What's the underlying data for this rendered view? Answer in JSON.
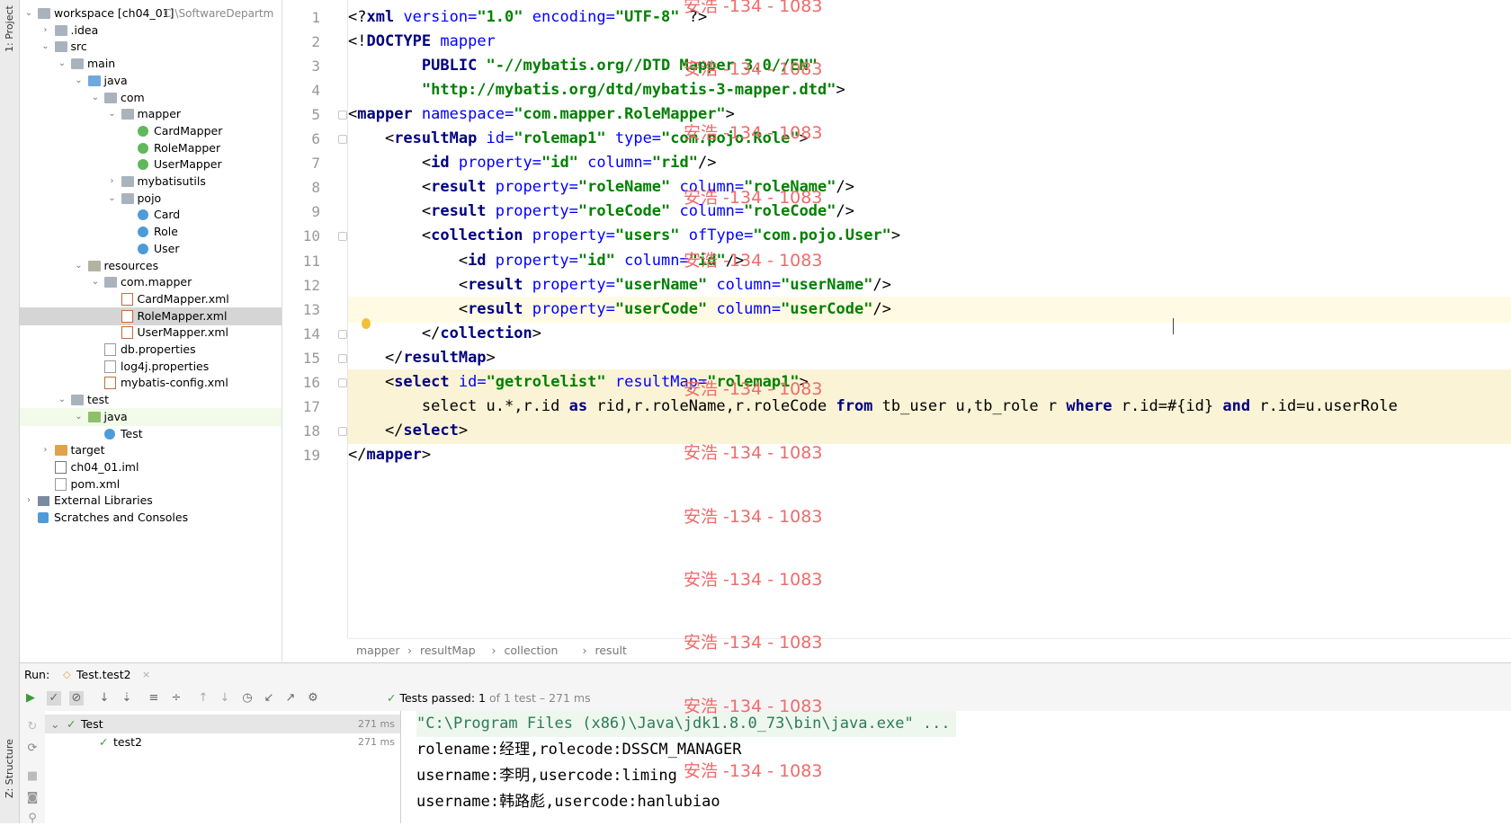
{
  "side_tabs": {
    "project": "1: Project",
    "structure": "Z: Structure"
  },
  "project_tree": [
    {
      "label": "workspace [ch04_01]",
      "hint": "C:\\SoftwareDepartm",
      "indent": 0,
      "chev": "v",
      "icon": "folder"
    },
    {
      "label": ".idea",
      "indent": 1,
      "chev": ">",
      "icon": "folder"
    },
    {
      "label": "src",
      "indent": 1,
      "chev": "v",
      "icon": "folder"
    },
    {
      "label": "main",
      "indent": 2,
      "chev": "v",
      "icon": "folder"
    },
    {
      "label": "java",
      "indent": 3,
      "chev": "v",
      "icon": "folder blue"
    },
    {
      "label": "com",
      "indent": 4,
      "chev": "v",
      "icon": "folder"
    },
    {
      "label": "mapper",
      "indent": 5,
      "chev": "v",
      "icon": "folder"
    },
    {
      "label": "CardMapper",
      "indent": 6,
      "chev": "",
      "icon": "interface"
    },
    {
      "label": "RoleMapper",
      "indent": 6,
      "chev": "",
      "icon": "interface"
    },
    {
      "label": "UserMapper",
      "indent": 6,
      "chev": "",
      "icon": "interface"
    },
    {
      "label": "mybatisutils",
      "indent": 5,
      "chev": ">",
      "icon": "folder"
    },
    {
      "label": "pojo",
      "indent": 5,
      "chev": "v",
      "icon": "folder"
    },
    {
      "label": "Card",
      "indent": 6,
      "chev": "",
      "icon": "klass"
    },
    {
      "label": "Role",
      "indent": 6,
      "chev": "",
      "icon": "klass"
    },
    {
      "label": "User",
      "indent": 6,
      "chev": "",
      "icon": "klass"
    },
    {
      "label": "resources",
      "indent": 3,
      "chev": "v",
      "icon": "folder res"
    },
    {
      "label": "com.mapper",
      "indent": 4,
      "chev": "v",
      "icon": "folder"
    },
    {
      "label": "CardMapper.xml",
      "indent": 5,
      "chev": "",
      "icon": "file"
    },
    {
      "label": "RoleMapper.xml",
      "indent": 5,
      "chev": "",
      "icon": "file",
      "state": "sel"
    },
    {
      "label": "UserMapper.xml",
      "indent": 5,
      "chev": "",
      "icon": "file"
    },
    {
      "label": "db.properties",
      "indent": 4,
      "chev": "",
      "icon": "props"
    },
    {
      "label": "log4j.properties",
      "indent": 4,
      "chev": "",
      "icon": "props"
    },
    {
      "label": "mybatis-config.xml",
      "indent": 4,
      "chev": "",
      "icon": "file"
    },
    {
      "label": "test",
      "indent": 2,
      "chev": "v",
      "icon": "folder"
    },
    {
      "label": "java",
      "indent": 3,
      "chev": "v",
      "icon": "folder green",
      "state": "gsel"
    },
    {
      "label": "Test",
      "indent": 4,
      "chev": "",
      "icon": "klass"
    },
    {
      "label": "target",
      "indent": 1,
      "chev": ">",
      "icon": "folder orange"
    },
    {
      "label": "ch04_01.iml",
      "indent": 1,
      "chev": "",
      "icon": "iml"
    },
    {
      "label": "pom.xml",
      "indent": 1,
      "chev": "",
      "icon": "props"
    },
    {
      "label": "External Libraries",
      "indent": 0,
      "chev": ">",
      "icon": "lib"
    },
    {
      "label": "Scratches and Consoles",
      "indent": 0,
      "chev": "",
      "icon": "scratch"
    }
  ],
  "editor": {
    "line_numbers": [
      "1",
      "2",
      "3",
      "4",
      "5",
      "6",
      "7",
      "8",
      "9",
      "10",
      "11",
      "12",
      "13",
      "14",
      "15",
      "16",
      "17",
      "18",
      "19"
    ],
    "lines": [
      [
        [
          "plain",
          "<?"
        ],
        [
          "tag",
          "xml"
        ],
        [
          "attr",
          " version="
        ],
        [
          "val",
          "\"1.0\""
        ],
        [
          "attr",
          " encoding="
        ],
        [
          "val",
          "\"UTF-8\""
        ],
        [
          "plain",
          " ?>"
        ]
      ],
      [
        [
          "plain",
          "<!"
        ],
        [
          "tag",
          "DOCTYPE"
        ],
        [
          "attr",
          " mapper"
        ]
      ],
      [
        [
          "plain",
          "        "
        ],
        [
          "tag",
          "PUBLIC"
        ],
        [
          "val",
          " \"-//mybatis.org//DTD Mapper 3.0//EN\""
        ]
      ],
      [
        [
          "plain",
          "        "
        ],
        [
          "val",
          "\"http://mybatis.org/dtd/mybatis-3-mapper.dtd\""
        ],
        [
          "plain",
          ">"
        ]
      ],
      [
        [
          "plain",
          "<"
        ],
        [
          "tag",
          "mapper"
        ],
        [
          "attr",
          " namespace="
        ],
        [
          "val",
          "\"com.mapper.RoleMapper\""
        ],
        [
          "plain",
          ">"
        ]
      ],
      [
        [
          "plain",
          "    <"
        ],
        [
          "tag",
          "resultMap"
        ],
        [
          "attr",
          " id="
        ],
        [
          "val",
          "\"rolemap1\""
        ],
        [
          "attr",
          " type="
        ],
        [
          "val",
          "\"com.pojo.Role\""
        ],
        [
          "plain",
          ">"
        ]
      ],
      [
        [
          "plain",
          "        <"
        ],
        [
          "tag",
          "id"
        ],
        [
          "attr",
          " property="
        ],
        [
          "val",
          "\"id\""
        ],
        [
          "attr",
          " column="
        ],
        [
          "val",
          "\"rid\""
        ],
        [
          "plain",
          "/>"
        ]
      ],
      [
        [
          "plain",
          "        <"
        ],
        [
          "tag",
          "result"
        ],
        [
          "attr",
          " property="
        ],
        [
          "val",
          "\"roleName\""
        ],
        [
          "attr",
          " column="
        ],
        [
          "val",
          "\"roleName\""
        ],
        [
          "plain",
          "/>"
        ]
      ],
      [
        [
          "plain",
          "        <"
        ],
        [
          "tag",
          "result"
        ],
        [
          "attr",
          " property="
        ],
        [
          "val",
          "\"roleCode\""
        ],
        [
          "attr",
          " column="
        ],
        [
          "val",
          "\"roleCode\""
        ],
        [
          "plain",
          "/>"
        ]
      ],
      [
        [
          "plain",
          "        <"
        ],
        [
          "tag",
          "collection"
        ],
        [
          "attr",
          " property="
        ],
        [
          "val",
          "\"users\""
        ],
        [
          "attr",
          " ofType="
        ],
        [
          "val",
          "\"com.pojo.User\""
        ],
        [
          "plain",
          ">"
        ]
      ],
      [
        [
          "plain",
          "            <"
        ],
        [
          "tag",
          "id"
        ],
        [
          "attr",
          " property="
        ],
        [
          "val",
          "\"id\""
        ],
        [
          "attr",
          " column="
        ],
        [
          "val",
          "\"id\""
        ],
        [
          "plain",
          "/>"
        ]
      ],
      [
        [
          "plain",
          "            <"
        ],
        [
          "tag",
          "result"
        ],
        [
          "attr",
          " property="
        ],
        [
          "val",
          "\"userName\""
        ],
        [
          "attr",
          " column="
        ],
        [
          "val",
          "\"userName\""
        ],
        [
          "plain",
          "/>"
        ]
      ],
      [
        [
          "plain",
          "            <"
        ],
        [
          "tag",
          "result"
        ],
        [
          "attr",
          " property="
        ],
        [
          "val",
          "\"userCode\""
        ],
        [
          "attr",
          " column="
        ],
        [
          "val",
          "\"userCode\""
        ],
        [
          "plain",
          "/>"
        ]
      ],
      [
        [
          "plain",
          "        </"
        ],
        [
          "tag",
          "collection"
        ],
        [
          "plain",
          ">"
        ]
      ],
      [
        [
          "plain",
          "    </"
        ],
        [
          "tag",
          "resultMap"
        ],
        [
          "plain",
          ">"
        ]
      ],
      [
        [
          "plain",
          "    <"
        ],
        [
          "tag",
          "select"
        ],
        [
          "attr",
          " id="
        ],
        [
          "val",
          "\"getrolelist\""
        ],
        [
          "attr",
          " resultMap="
        ],
        [
          "val",
          "\"rolemap1\""
        ],
        [
          "plain",
          ">"
        ]
      ],
      [
        [
          "plain",
          "        select u.*,r.id "
        ],
        [
          "kw",
          "as"
        ],
        [
          "plain",
          " rid,r.roleName,r.roleCode "
        ],
        [
          "kw",
          "from"
        ],
        [
          "plain",
          " tb_user u,tb_role r "
        ],
        [
          "kw",
          "where"
        ],
        [
          "plain",
          " r.id=#{id} "
        ],
        [
          "kw",
          "and"
        ],
        [
          "plain",
          " r.id=u.userRole"
        ]
      ],
      [
        [
          "plain",
          "    </"
        ],
        [
          "tag",
          "select"
        ],
        [
          "plain",
          ">"
        ]
      ],
      [
        [
          "plain",
          "</"
        ],
        [
          "tag",
          "mapper"
        ],
        [
          "plain",
          ">"
        ]
      ]
    ]
  },
  "breadcrumb": [
    "mapper",
    "resultMap",
    "collection",
    "result"
  ],
  "run": {
    "label": "Run:",
    "tab": "Test.test2",
    "status_prefix": "Tests passed:",
    "status_count": "1",
    "status_rest": "of 1 test – 271 ms",
    "tree": [
      {
        "name": "Test",
        "time": "271 ms"
      },
      {
        "name": "test2",
        "time": "271 ms"
      }
    ],
    "console": [
      "\"C:\\Program Files (x86)\\Java\\jdk1.8.0_73\\bin\\java.exe\" ...",
      "rolename:经理,rolecode:DSSCM_MANAGER",
      "username:李明,usercode:liming",
      "username:韩路彪,usercode:hanlubiao"
    ]
  },
  "watermark": "安浩 -134 - 1083",
  "colors": {
    "tag": "#000080",
    "attr": "#0000ff",
    "value": "#008000",
    "watermark": "#ef6b6b",
    "pass": "#3c9a3c"
  }
}
